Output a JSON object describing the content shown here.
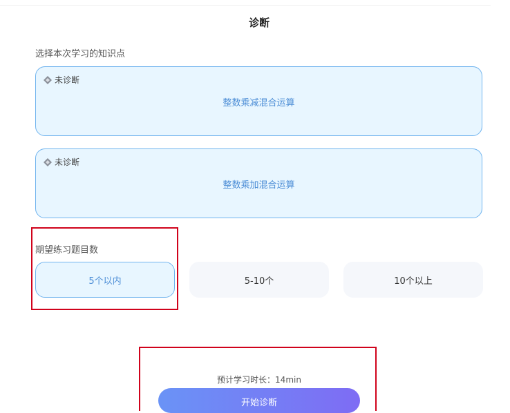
{
  "page": {
    "title": "诊断"
  },
  "knowledge": {
    "label": "选择本次学习的知识点",
    "items": [
      {
        "status": "未诊断",
        "name": "整数乘减混合运算"
      },
      {
        "status": "未诊断",
        "name": "整数乘加混合运算"
      }
    ]
  },
  "count": {
    "label": "期望练习题目数",
    "options": [
      {
        "label": "5个以内",
        "selected": true
      },
      {
        "label": "5-10个",
        "selected": false
      },
      {
        "label": "10个以上",
        "selected": false
      }
    ]
  },
  "footer": {
    "estimate": "预计学习时长：14min",
    "start_label": "开始诊断"
  },
  "colors": {
    "accent": "#4c8dd6",
    "highlight": "#d0021b",
    "button_start": "#6a93f6",
    "button_end": "#7e6cf4"
  }
}
